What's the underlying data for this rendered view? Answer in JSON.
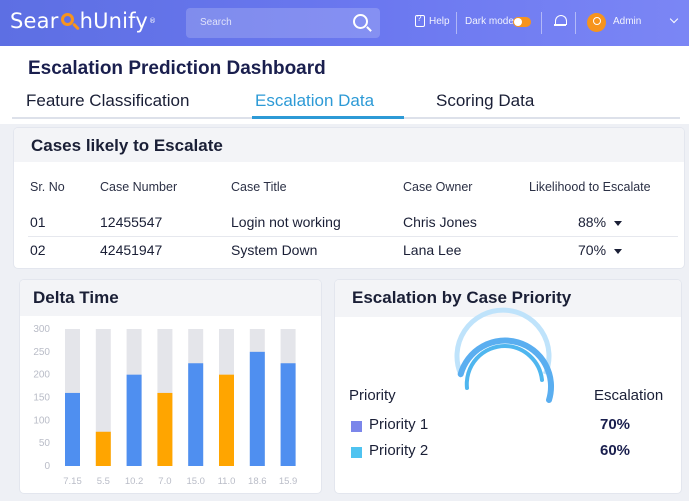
{
  "header": {
    "logo_text": "SearchUnify",
    "logo_prefix": "Sear",
    "logo_suffix": "hUnify",
    "logo_mark": "®",
    "search_placeholder": "Search",
    "help_label": "Help",
    "dark_mode_label": "Dark mode",
    "dark_mode_on": true,
    "user_name": "Admin",
    "accent_color": "#f7941d",
    "bar_color": "#6b78f0"
  },
  "page": {
    "title": "Escalation Prediction Dashboard",
    "tabs": [
      {
        "label": "Feature Classification",
        "active": false
      },
      {
        "label": "Escalation Data",
        "active": true
      },
      {
        "label": "Scoring Data",
        "active": false
      }
    ]
  },
  "cases": {
    "title": "Cases likely to Escalate",
    "columns": [
      "Sr. No",
      "Case Number",
      "Case Title",
      "Case Owner",
      "Likelihood to Escalate"
    ],
    "rows": [
      {
        "sr": "01",
        "number": "12455547",
        "title": "Login not working",
        "owner": "Chris Jones",
        "likelihood": "88%"
      },
      {
        "sr": "02",
        "number": "42451947",
        "title": "System Down",
        "owner": "Lana Lee",
        "likelihood": "70%"
      }
    ]
  },
  "delta": {
    "title": "Delta Time"
  },
  "priority": {
    "title": "Escalation by Case Priority",
    "col_priority": "Priority",
    "col_escalation": "Escalation",
    "items": [
      {
        "label": "Priority 1",
        "value": "70%",
        "color": "#7b86ea"
      },
      {
        "label": "Priority 2",
        "value": "60%",
        "color": "#4fc3f0"
      }
    ],
    "gauge_color": "#5aaef0"
  },
  "chart_data": {
    "type": "bar",
    "categories": [
      "7.15",
      "5.5",
      "10.2",
      "7.0",
      "15.0",
      "11.0",
      "18.6",
      "15.9"
    ],
    "values": [
      160,
      75,
      200,
      160,
      225,
      200,
      250,
      225
    ],
    "max_values": [
      300,
      300,
      300,
      300,
      300,
      300,
      300,
      300
    ],
    "bar_colors": [
      "#4f8ff0",
      "#ffa500",
      "#4f8ff0",
      "#ffa500",
      "#4f8ff0",
      "#ffa500",
      "#4f8ff0",
      "#4f8ff0"
    ],
    "ylim": [
      0,
      300
    ],
    "yticks": [
      0,
      50,
      100,
      150,
      200,
      250,
      300
    ],
    "xlabel": "",
    "ylabel": ""
  }
}
